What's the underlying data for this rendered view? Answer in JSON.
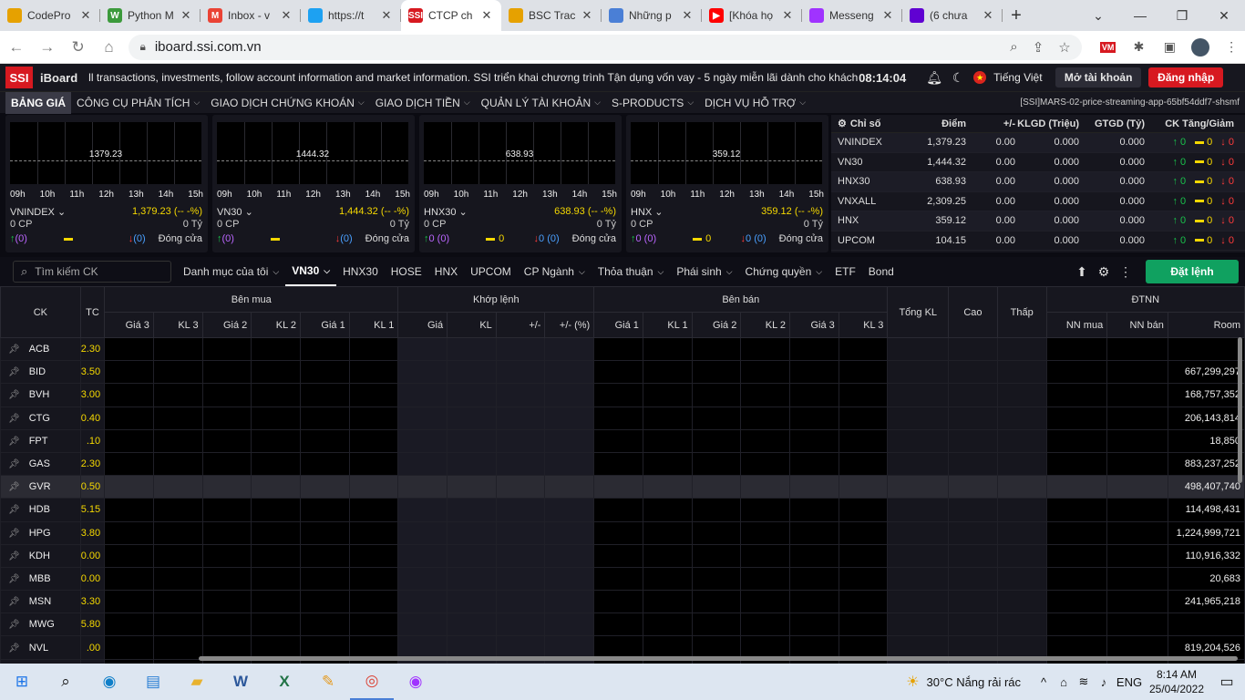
{
  "browser": {
    "tabs": [
      {
        "title": "CodePro",
        "icon": "codepro-icon",
        "color": "#e6a100",
        "fav": ""
      },
      {
        "title": "Python M",
        "icon": "w3schools-icon",
        "color": "#3c9a3c",
        "fav": "W"
      },
      {
        "title": "Inbox - v",
        "icon": "gmail-icon",
        "color": "#ea4335",
        "fav": "M"
      },
      {
        "title": "https://t",
        "icon": "twitter-icon",
        "color": "#1da1f2",
        "fav": ""
      },
      {
        "title": "CTCP ch",
        "icon": "ssi-icon",
        "color": "#d71920",
        "fav": "SSI"
      },
      {
        "title": "BSC Trac",
        "icon": "bsc-icon",
        "color": "#e6a100",
        "fav": ""
      },
      {
        "title": "Những p",
        "icon": "chart-icon",
        "color": "#4a7fd6",
        "fav": ""
      },
      {
        "title": "[Khóa họ",
        "icon": "youtube-icon",
        "color": "#ff0000",
        "fav": "▶"
      },
      {
        "title": "Messeng",
        "icon": "messenger-icon",
        "color": "#a033ff",
        "fav": ""
      },
      {
        "title": "(6 chưa",
        "icon": "yahoo-mail-icon",
        "color": "#6001d2",
        "fav": ""
      }
    ],
    "active_tab": 4,
    "url": "iboard.ssi.com.vn"
  },
  "app": {
    "logo": "SSI",
    "brand": "iBoard",
    "ticker": "ll transactions, investments, follow account information and market information.      SSI triển khai chương trình Tận dụng vốn vay - 5 ngày miễn lãi dành cho khách hàng đăng",
    "clock": "08:14:04",
    "language": "Tiếng Việt",
    "open_account": "Mở tài khoản",
    "login": "Đăng nhập",
    "menu": [
      "BẢNG GIÁ",
      "CÔNG CỤ PHÂN TÍCH",
      "GIAO DỊCH CHỨNG KHOÁN",
      "GIAO DỊCH TIỀN",
      "QUẢN LÝ TÀI KHOẢN",
      "S-PRODUCTS",
      "DỊCH VỤ HỖ TRỢ"
    ],
    "build_tag": "[SSI]MARS-02-price-streaming-app-65bf54ddf7-shsmf"
  },
  "cards": {
    "hours": [
      "09h",
      "10h",
      "11h",
      "12h",
      "13h",
      "14h",
      "15h"
    ],
    "items": [
      {
        "chart_value": "1379.23",
        "name": "VNINDEX",
        "value": "1,379.23 (-- -%)",
        "volume": "0 CP",
        "turnover": "0 Tỷ",
        "up": "(0)",
        "ref": "",
        "down": "(0)",
        "status": "Đóng cửa"
      },
      {
        "chart_value": "1444.32",
        "name": "VN30",
        "value": "1,444.32 (-- -%)",
        "volume": "0 CP",
        "turnover": "0 Tỷ",
        "up": "(0)",
        "ref": "",
        "down": "(0)",
        "status": "Đóng cửa"
      },
      {
        "chart_value": "638.93",
        "name": "HNX30",
        "value": "638.93 (-- -%)",
        "volume": "0 CP",
        "turnover": "0 Tỷ",
        "up": "0 (0)",
        "ref": "0",
        "down": "0 (0)",
        "status": "Đóng cửa"
      },
      {
        "chart_value": "359.12",
        "name": "HNX",
        "value": "359.12 (-- -%)",
        "volume": "0 CP",
        "turnover": "0 Tỷ",
        "up": "0 (0)",
        "ref": "0",
        "down": "0 (0)",
        "status": "Đóng cửa"
      }
    ]
  },
  "index_table": {
    "headers": [
      "Chỉ số",
      "Điểm",
      "+/-",
      "KLGD (Triệu)",
      "GTGD (Tỷ)",
      "CK Tăng/Giảm"
    ],
    "rows": [
      {
        "name": "VNINDEX",
        "point": "1,379.23",
        "chg": "0.00",
        "vol": "0.000",
        "val": "0.000",
        "up": "0",
        "ref": "0",
        "down": "0"
      },
      {
        "name": "VN30",
        "point": "1,444.32",
        "chg": "0.00",
        "vol": "0.000",
        "val": "0.000",
        "up": "0",
        "ref": "0",
        "down": "0"
      },
      {
        "name": "HNX30",
        "point": "638.93",
        "chg": "0.00",
        "vol": "0.000",
        "val": "0.000",
        "up": "0",
        "ref": "0",
        "down": "0"
      },
      {
        "name": "VNXALL",
        "point": "2,309.25",
        "chg": "0.00",
        "vol": "0.000",
        "val": "0.000",
        "up": "0",
        "ref": "0",
        "down": "0"
      },
      {
        "name": "HNX",
        "point": "359.12",
        "chg": "0.00",
        "vol": "0.000",
        "val": "0.000",
        "up": "0",
        "ref": "0",
        "down": "0"
      },
      {
        "name": "UPCOM",
        "point": "104.15",
        "chg": "0.00",
        "vol": "0.000",
        "val": "0.000",
        "up": "0",
        "ref": "0",
        "down": "0"
      }
    ]
  },
  "filter": {
    "search_placeholder": "Tìm kiếm CK",
    "tabs": [
      {
        "label": "Danh mục của tôi",
        "dd": true
      },
      {
        "label": "VN30",
        "dd": true,
        "active": true
      },
      {
        "label": "HNX30",
        "dd": false
      },
      {
        "label": "HOSE",
        "dd": false
      },
      {
        "label": "HNX",
        "dd": false
      },
      {
        "label": "UPCOM",
        "dd": false
      },
      {
        "label": "CP Ngành",
        "dd": true
      },
      {
        "label": "Thỏa thuận",
        "dd": true
      },
      {
        "label": "Phái sinh",
        "dd": true
      },
      {
        "label": "Chứng quyền",
        "dd": true
      },
      {
        "label": "ETF",
        "dd": false
      },
      {
        "label": "Bond",
        "dd": false
      }
    ],
    "order_button": "Đặt lệnh"
  },
  "board": {
    "groups": {
      "ck": "CK",
      "tc": "TC",
      "buy": "Bên mua",
      "match": "Khớp lệnh",
      "sell": "Bên bán",
      "total": "Tổng KL",
      "high": "Cao",
      "low": "Thấp",
      "foreign": "ĐTNN"
    },
    "subheaders": {
      "buy": [
        "Giá 3",
        "KL 3",
        "Giá 2",
        "KL 2",
        "Giá 1",
        "KL 1"
      ],
      "match": [
        "Giá",
        "KL",
        "+/-",
        "+/- (%)"
      ],
      "sell": [
        "Giá 1",
        "KL 1",
        "Giá 2",
        "KL 2",
        "Giá 3",
        "KL 3"
      ],
      "foreign": [
        "NN mua",
        "NN bán",
        "Room"
      ]
    },
    "rows": [
      {
        "ck": "ACB",
        "tc": "2.30",
        "room": ""
      },
      {
        "ck": "BID",
        "tc": "3.50",
        "room": "667,299,297"
      },
      {
        "ck": "BVH",
        "tc": "3.00",
        "room": "168,757,352"
      },
      {
        "ck": "CTG",
        "tc": "0.40",
        "room": "206,143,814"
      },
      {
        "ck": "FPT",
        "tc": ".10",
        "room": "18,850"
      },
      {
        "ck": "GAS",
        "tc": "2.30",
        "room": "883,237,252"
      },
      {
        "ck": "GVR",
        "tc": "0.50",
        "room": "498,407,740",
        "hl": true
      },
      {
        "ck": "HDB",
        "tc": "5.15",
        "room": "114,498,431"
      },
      {
        "ck": "HPG",
        "tc": "3.80",
        "room": "1,224,999,721"
      },
      {
        "ck": "KDH",
        "tc": "0.00",
        "room": "110,916,332"
      },
      {
        "ck": "MBB",
        "tc": "0.00",
        "room": "20,683"
      },
      {
        "ck": "MSN",
        "tc": "3.30",
        "room": "241,965,218"
      },
      {
        "ck": "MWG",
        "tc": "5.80",
        "room": ""
      },
      {
        "ck": "NVL",
        "tc": ".00",
        "room": "819,204,526"
      },
      {
        "ck": "",
        "tc": "",
        "room": ""
      }
    ]
  },
  "taskbar": {
    "weather": "30°C  Nắng rải rác",
    "lang": "ENG",
    "time": "8:14 AM",
    "date": "25/04/2022"
  }
}
